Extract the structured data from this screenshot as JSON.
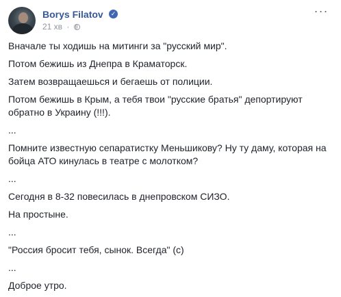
{
  "post": {
    "author": "Borys Filatov",
    "timestamp": "21 хв",
    "separator": "·",
    "privacy_icon": "globe-icon",
    "verified_icon": "verified-badge-icon",
    "more_label": "···",
    "paragraphs": [
      "Вначале ты ходишь на митинги за \"русский мир\".",
      "Потом бежишь из Днепра в Краматорск.",
      "Затем возвращаешься и бегаешь от полиции.",
      "Потом бежишь в Крым, а тебя твои \"русские братья\" депортируют обратно в Украину (!!!).",
      "...",
      "Помните известную сепаратистку Меньшикову? Ну ту даму, которая на бойца АТО кинулась в театре с молотком?",
      "...",
      "Сегодня в 8-32 повесилась в днепровском СИЗО.",
      "На простыне.",
      "...",
      "\"Россия бросит тебя, сынок. Всегда\" (с)",
      "...",
      "Доброе утро."
    ]
  },
  "colors": {
    "author": "#365899",
    "text": "#1d2129",
    "meta": "#90949c",
    "verified": "#4267b2"
  }
}
